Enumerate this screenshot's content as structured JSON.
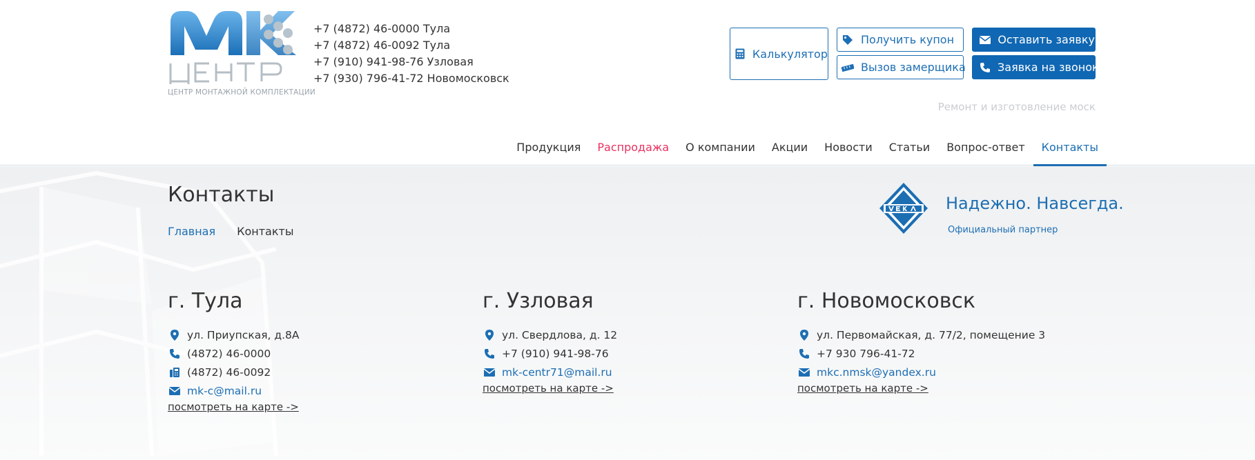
{
  "colors": {
    "primary": "#1067b3",
    "accent_text": "#1c6eb3",
    "sale": "#e8325f",
    "ticker": "#c9cdd1"
  },
  "logo": {
    "subtitle": "ЦЕНТР МОНТАЖНОЙ КОМПЛЕКТАЦИИ"
  },
  "phones": [
    "+7 (4872) 46-0000 Тула",
    "+7 (4872) 46-0092 Тула",
    "+7 (910) 941-98-76 Узловая",
    "+7 (930) 796-41-72 Новомосковск"
  ],
  "buttons": {
    "calculator": {
      "label": "Калькулятор",
      "icon": "calculator-icon"
    },
    "coupon": {
      "label": "Получить купон",
      "icon": "tag-icon"
    },
    "measure": {
      "label": "Вызов замерщика",
      "icon": "ruler-icon"
    },
    "request": {
      "label": "Оставить заявку",
      "icon": "envelope-icon"
    },
    "callback": {
      "label": "Заявка на звонок",
      "icon": "phone-icon"
    }
  },
  "ticker": "Ремонт и изготовление моск",
  "nav": [
    {
      "label": "Продукция"
    },
    {
      "label": "Распродажа"
    },
    {
      "label": "О компании"
    },
    {
      "label": "Акции"
    },
    {
      "label": "Новости"
    },
    {
      "label": "Статьи"
    },
    {
      "label": "Вопрос-ответ"
    },
    {
      "label": "Контакты"
    }
  ],
  "page": {
    "title": "Контакты",
    "breadcrumbs": {
      "home": "Главная",
      "current": "Контакты"
    }
  },
  "partner": {
    "slogan": "Надежно. Навсегда.",
    "note": "Официальный партнер"
  },
  "cities": {
    "tula": {
      "name": "г. Тула",
      "address": "ул. Приупская, д.8А",
      "phone": "(4872) 46-0000",
      "fax": "(4872) 46-0092",
      "email": "mk-c@mail.ru",
      "map_link": "посмотреть на карте ->"
    },
    "uzlovaya": {
      "name": "г. Узловая",
      "address": "ул. Свердлова, д. 12",
      "phone": "+7 (910) 941-98-76",
      "email": "mk-centr71@mail.ru",
      "map_link": "посмотреть на карте ->"
    },
    "novomoskovsk": {
      "name": "г. Новомосковск",
      "address": "ул. Первомайская, д. 77/2, помещение 3",
      "phone": "+7 930 796-41-72",
      "email": "mkc.nmsk@yandex.ru",
      "map_link": "посмотреть на карте ->"
    }
  }
}
